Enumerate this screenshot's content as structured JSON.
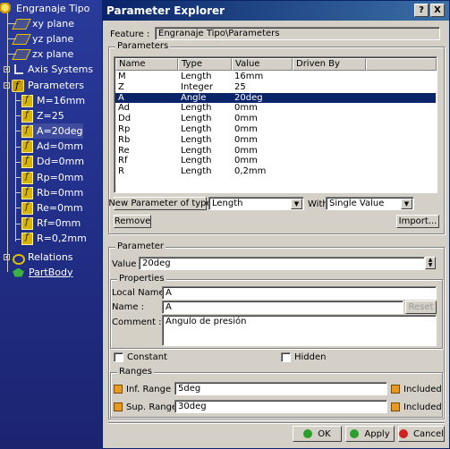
{
  "tree": {
    "root": "Engranaje Tipo",
    "planes": [
      "xy plane",
      "yz plane",
      "zx plane"
    ],
    "axis_systems": "Axis Systems",
    "parameters": "Parameters",
    "param_items": [
      "M=16mm",
      "Z=25",
      "A=20deg",
      "Ad=0mm",
      "Dd=0mm",
      "Rp=0mm",
      "Rb=0mm",
      "Re=0mm",
      "Rf=0mm",
      "R=0,2mm"
    ],
    "relations": "Relations",
    "part_body": "PartBody"
  },
  "dialog": {
    "title": "Parameter Explorer",
    "help_btn": "?",
    "close_btn": "X",
    "feature_label": "Feature :",
    "feature_value": "Engranaje Tipo\\Parameters",
    "parameters_group": "Parameters",
    "columns": [
      "Name",
      "Type",
      "Value",
      "Driven By"
    ],
    "rows": [
      [
        "M",
        "Length",
        "16mm",
        ""
      ],
      [
        "Z",
        "Integer",
        "25",
        ""
      ],
      [
        "A",
        "Angle",
        "20deg",
        ""
      ],
      [
        "Ad",
        "Length",
        "0mm",
        ""
      ],
      [
        "Dd",
        "Length",
        "0mm",
        ""
      ],
      [
        "Rp",
        "Length",
        "0mm",
        ""
      ],
      [
        "Rb",
        "Length",
        "0mm",
        ""
      ],
      [
        "Re",
        "Length",
        "0mm",
        ""
      ],
      [
        "Rf",
        "Length",
        "0mm",
        ""
      ],
      [
        "R",
        "Length",
        "0,2mm",
        ""
      ]
    ],
    "new_param_btn": "New Parameter of type",
    "new_param_type": "Length",
    "with_label": "With",
    "with_value": "Single Value",
    "remove_btn": "Remove",
    "import_btn": "Import...",
    "parameter_group": "Parameter",
    "value_label": "Value :",
    "value": "20deg",
    "properties_group": "Properties",
    "local_name_label": "Local Name :",
    "local_name": "A",
    "name_label": "Name :",
    "name": "A",
    "reset_btn": "Reset",
    "comment_label": "Comment :",
    "comment": "Angulo de presión",
    "constant_label": "Constant",
    "hidden_label": "Hidden",
    "ranges_group": "Ranges",
    "inf_range_label": "Inf. Range",
    "inf_range": "5deg",
    "sup_range_label": "Sup. Range",
    "sup_range": "30deg",
    "included_1": "Included",
    "included_2": "Included",
    "ok_btn": "OK",
    "apply_btn": "Apply",
    "cancel_btn": "Cancel"
  },
  "colors": {
    "title_bar": "#0a246a",
    "selection": "#0a246a",
    "dialog_bg": "#d4d0c8",
    "ok_dot": "#2aa02a",
    "apply_dot": "#2aa02a",
    "cancel_dot": "#d02020"
  }
}
